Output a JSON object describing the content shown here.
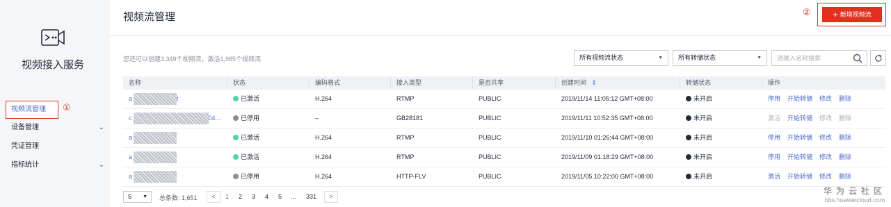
{
  "sidebar": {
    "service_title": "视频接入服务",
    "items": [
      {
        "label": "视频流管理",
        "active": true
      },
      {
        "label": "设备管理",
        "expandable": true
      },
      {
        "label": "凭证管理"
      },
      {
        "label": "指标统计",
        "expandable": true
      }
    ]
  },
  "callouts": {
    "one": "①",
    "two": "②"
  },
  "header": {
    "title": "视频流管理",
    "add_button": "新增视频流"
  },
  "toolbar": {
    "quota_text": "您还可以创建3,349个视频流，激活1,985个视频流",
    "status_filter": "所有视频流状态",
    "transfer_filter": "所有转储状态",
    "search_placeholder": "请输入名称搜索"
  },
  "table": {
    "columns": [
      "名称",
      "状态",
      "编码格式",
      "接入类型",
      "是否共享",
      "创建时间",
      "转储状态",
      "操作"
    ],
    "rows": [
      {
        "name_prefix": "a",
        "name_suffix": "t",
        "status": "已激活",
        "status_kind": "active",
        "codec": "H.264",
        "access": "RTMP",
        "share": "PUBLIC",
        "created": "2019/11/14 11:05:12 GMT+08:00",
        "transfer": "未开启",
        "actions": [
          "停用",
          "开始转储",
          "修改",
          "删除"
        ],
        "enabled": [
          true,
          true,
          true,
          true
        ]
      },
      {
        "name_prefix": "c",
        "name_suffix": "04...",
        "status": "已停用",
        "status_kind": "stopped",
        "codec": "–",
        "access": "GB28181",
        "share": "PUBLIC",
        "created": "2019/11/11 10:52:35 GMT+08:00",
        "transfer": "未开启",
        "actions": [
          "激活",
          "开始转储",
          "修改",
          "删除"
        ],
        "enabled": [
          false,
          true,
          false,
          false
        ]
      },
      {
        "name_prefix": "a",
        "name_suffix": "",
        "status": "已激活",
        "status_kind": "active",
        "codec": "H.264",
        "access": "RTMP",
        "share": "PUBLIC",
        "created": "2019/11/10 01:26:44 GMT+08:00",
        "transfer": "未开启",
        "actions": [
          "停用",
          "开始转储",
          "修改",
          "删除"
        ],
        "enabled": [
          true,
          true,
          true,
          true
        ]
      },
      {
        "name_prefix": "a",
        "name_suffix": "",
        "status": "已激活",
        "status_kind": "active",
        "codec": "H.264",
        "access": "RTMP",
        "share": "PUBLIC",
        "created": "2019/11/09 01:18:29 GMT+08:00",
        "transfer": "未开启",
        "actions": [
          "停用",
          "开始转储",
          "修改",
          "删除"
        ],
        "enabled": [
          true,
          true,
          true,
          true
        ]
      },
      {
        "name_prefix": "a",
        "name_suffix": "",
        "status": "已停用",
        "status_kind": "stopped",
        "codec": "H.264",
        "access": "HTTP-FLV",
        "share": "PUBLIC",
        "created": "2019/11/05 10:22:00 GMT+08:00",
        "transfer": "未开启",
        "actions": [
          "激活",
          "开始转储",
          "修改",
          "删除"
        ],
        "enabled": [
          true,
          true,
          true,
          true
        ]
      }
    ]
  },
  "pagination": {
    "page_size": "5",
    "total": "总条数: 1,651",
    "pages": [
      "1",
      "2",
      "3",
      "4",
      "5",
      "...",
      "331"
    ],
    "current": "1",
    "prev": "<",
    "next": ">"
  },
  "watermark": {
    "line1": "华为云社区",
    "line2": "bbs.huaweicloud.com"
  },
  "colors": {
    "accent_red": "#e0301e",
    "link_blue": "#526ecc",
    "active_green": "#50d4ab"
  }
}
